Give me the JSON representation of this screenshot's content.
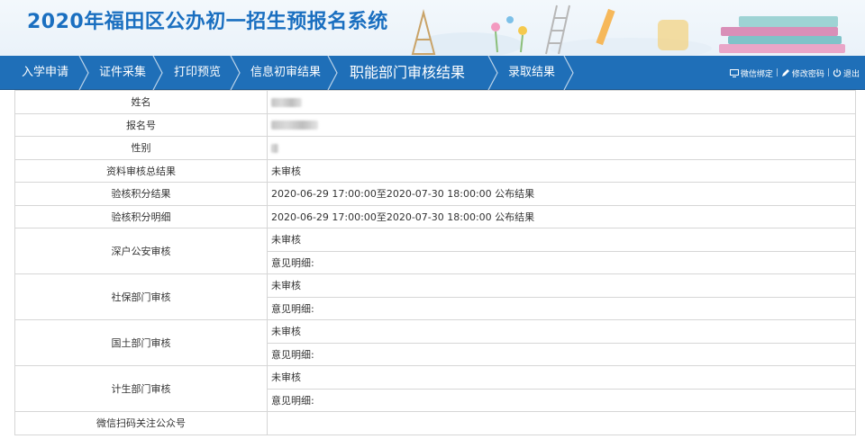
{
  "header": {
    "title": "2020年福田区公办初一招生预报名系统"
  },
  "nav": {
    "steps": [
      {
        "label": "入学申请"
      },
      {
        "label": "证件采集"
      },
      {
        "label": "打印预览"
      },
      {
        "label": "信息初审结果"
      },
      {
        "label": "职能部门审核结果"
      },
      {
        "label": "录取结果"
      }
    ],
    "links": {
      "wechat": "微信绑定",
      "password": "修改密码",
      "logout": "退出"
    }
  },
  "table": {
    "name_label": "姓名",
    "regno_label": "报名号",
    "gender_label": "性别",
    "review_label": "资料审核总结果",
    "review_value": "未审核",
    "points_label": "验核积分结果",
    "points_value": "2020-06-29 17:00:00至2020-07-30 18:00:00 公布结果",
    "detail_label": "验核积分明细",
    "detail_value": "2020-06-29 17:00:00至2020-07-30 18:00:00 公布结果",
    "depts": [
      {
        "label": "深户公安审核",
        "status": "未审核",
        "opinion": "意见明细:"
      },
      {
        "label": "社保部门审核",
        "status": "未审核",
        "opinion": "意见明细:"
      },
      {
        "label": "国土部门审核",
        "status": "未审核",
        "opinion": "意见明细:"
      },
      {
        "label": "计生部门审核",
        "status": "未审核",
        "opinion": "意见明细:"
      }
    ],
    "wechat_label": "微信扫码关注公众号"
  },
  "colors": {
    "nav_bg": "#1f6fb8",
    "title": "#1a6fc0",
    "status_red": "#d8001b"
  }
}
